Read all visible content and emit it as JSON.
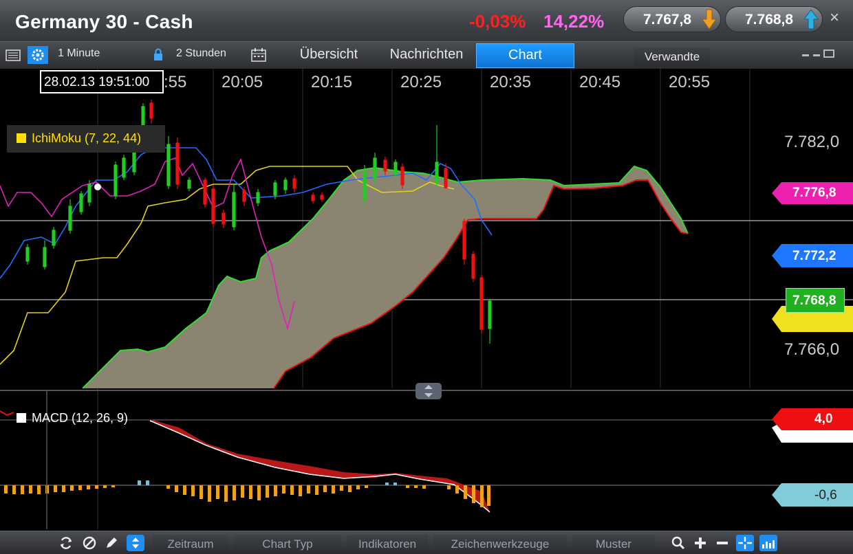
{
  "header": {
    "title": "Germany 30 - Cash",
    "change_percent": "-0,03%",
    "spread_percent": "14,22%",
    "sell_price": "7.767,8",
    "buy_price": "7.768,8",
    "close_symbol": "×"
  },
  "toolbar": {
    "interval": "1 Minute",
    "range": "2 Stunden",
    "tabs": [
      {
        "label": "Übersicht",
        "active": false
      },
      {
        "label": "Nachrichten",
        "active": false
      },
      {
        "label": "Chart",
        "active": true
      }
    ],
    "related": "Verwandte"
  },
  "chart": {
    "cursor_time": "28.02.13 19:51:00",
    "time_labels": [
      ":55",
      "20:05",
      "20:15",
      "20:25",
      "20:35",
      "20:45",
      "20:55"
    ],
    "price_labels": [
      "7.782,0",
      "7.766,0"
    ],
    "indicator_label": "IchiMoku (7, 22, 44)",
    "tags": {
      "magenta": "7.776,8",
      "blue": "7.772,2",
      "green": "7.768,8"
    },
    "colors": {
      "bullish": "#22cc22",
      "bearish": "#ee1111",
      "tenkan": "#1e6fff",
      "kijun": "#e8d020",
      "chikou": "#e020c0",
      "cloud": "#8a8470"
    }
  },
  "macd": {
    "label": "MACD (12, 26, 9)",
    "value_tag": "4,0",
    "histogram_tag": "-0,6"
  },
  "bottom_toolbar": {
    "menus": [
      "Zeitraum",
      "Chart Typ",
      "Indikatoren",
      "Zeichenwerkzeuge",
      "Muster"
    ]
  }
}
